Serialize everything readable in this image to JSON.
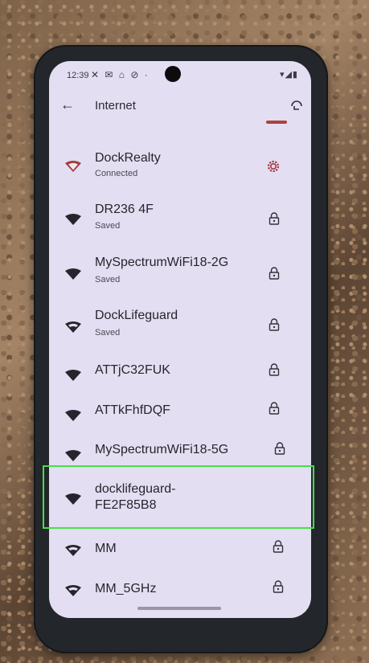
{
  "status": {
    "time": "12:39",
    "notifications": "✕ ✉ ⌂ ⊘ ·",
    "system": "▾◢▮"
  },
  "appbar": {
    "title": "Internet",
    "back_icon": "arrow-left",
    "qr_icon": "qr-scan"
  },
  "networks": [
    {
      "ssid": "DockRealty",
      "status": "Connected",
      "signal": "strong",
      "action": "settings-gear",
      "color": "#a03a3a"
    },
    {
      "ssid": "DR236 4F",
      "status": "Saved",
      "signal": "strong",
      "action": "lock"
    },
    {
      "ssid": "MySpectrumWiFi18-2G",
      "status": "Saved",
      "signal": "strong",
      "action": "lock"
    },
    {
      "ssid": "DockLifeguard",
      "status": "Saved",
      "signal": "medium",
      "action": "lock"
    },
    {
      "ssid": "ATTjC32FUK",
      "status": "",
      "signal": "strong",
      "action": "lock"
    },
    {
      "ssid": "ATTkFhfDQF",
      "status": "",
      "signal": "strong",
      "action": "lock"
    },
    {
      "ssid": "MySpectrumWiFi18-5G",
      "status": "",
      "signal": "strong",
      "action": "lock"
    },
    {
      "ssid_line1": "docklifeguard-",
      "ssid_line2": "FE2F85B8",
      "status": "",
      "signal": "strong",
      "action": "none"
    },
    {
      "ssid": "MM",
      "status": "",
      "signal": "medium",
      "action": "lock"
    },
    {
      "ssid": "MM_5GHz",
      "status": "",
      "signal": "medium",
      "action": "lock"
    }
  ],
  "colors": {
    "screen_bg": "#e4def2",
    "connected_accent": "#a03a3a",
    "highlight_box": "#44e046"
  }
}
